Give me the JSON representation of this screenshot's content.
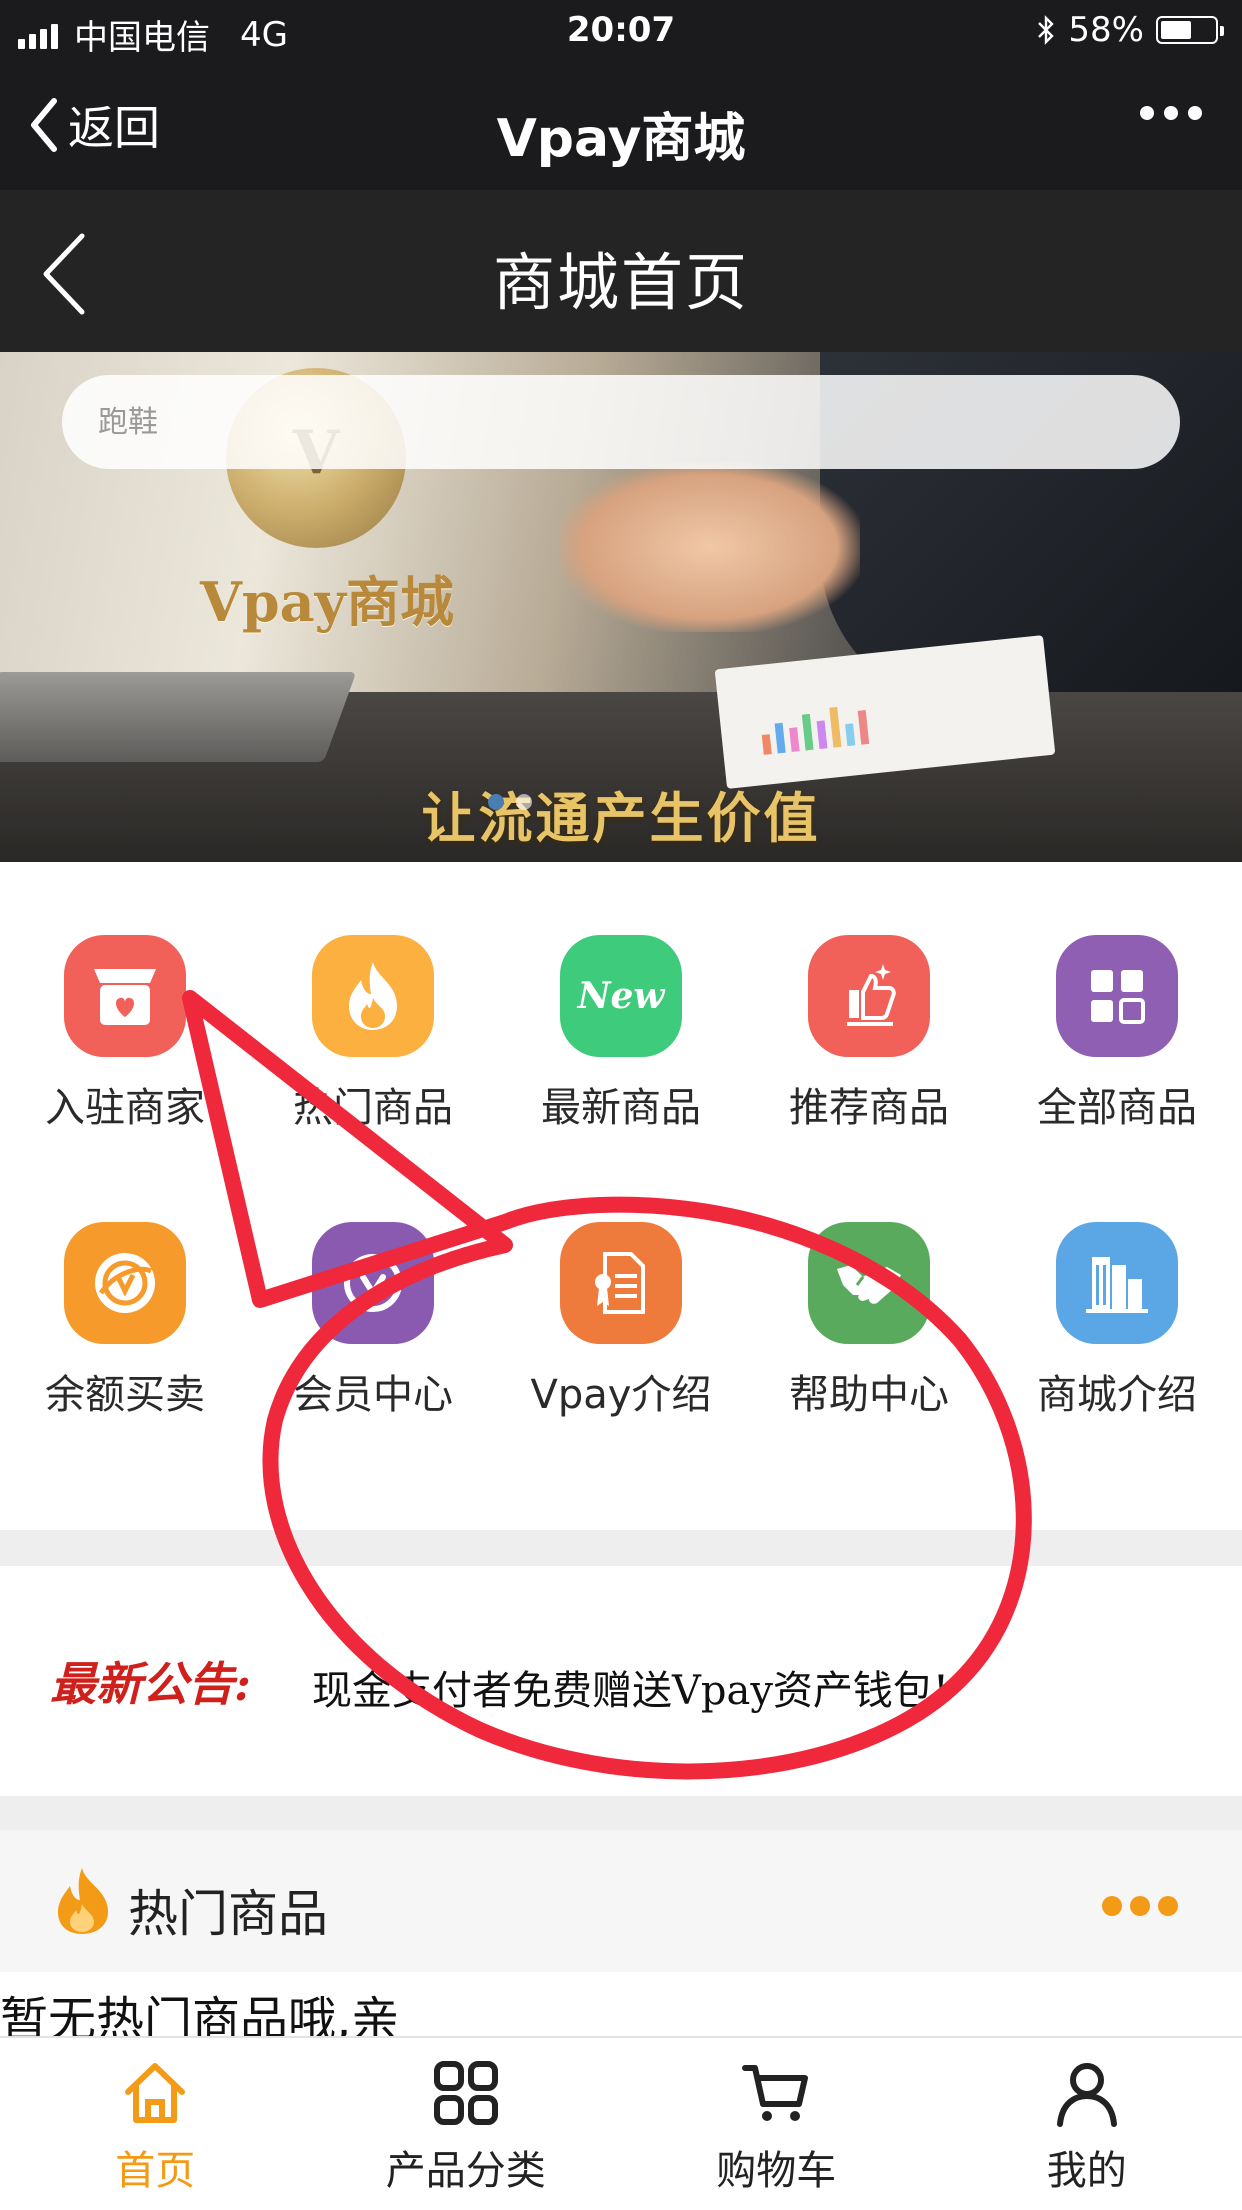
{
  "status_bar": {
    "carrier": "中国电信",
    "network": "4G",
    "time": "20:07",
    "battery": "58%",
    "battery_level": 0.58
  },
  "wechat_bar": {
    "back_label": "返回",
    "title": "Vpay商城"
  },
  "page_header": {
    "title": "商城首页"
  },
  "search": {
    "placeholder": "跑鞋"
  },
  "banner": {
    "brand": "Vpay商城",
    "slogan": "让流通产生价值"
  },
  "menu": [
    {
      "label": "入驻商家",
      "icon": "store-heart-icon",
      "color": "#f2605a"
    },
    {
      "label": "热门商品",
      "icon": "flame-icon",
      "color": "#fbb040"
    },
    {
      "label": "最新商品",
      "icon": "new-badge-icon",
      "icon_text": "New",
      "color": "#3ecb7b"
    },
    {
      "label": "推荐商品",
      "icon": "thumb-recommend-icon",
      "color": "#f2605a"
    },
    {
      "label": "全部商品",
      "icon": "grid-icon",
      "color": "#8e5fb3"
    },
    {
      "label": "余额买卖",
      "icon": "vpay-coin-icon",
      "color": "#f59a2b"
    },
    {
      "label": "会员中心",
      "icon": "member-badge-icon",
      "color": "#8a5ab0"
    },
    {
      "label": "Vpay介绍",
      "icon": "certificate-icon",
      "color": "#ee7a3c"
    },
    {
      "label": "帮助中心",
      "icon": "handshake-icon",
      "color": "#5aaa5e"
    },
    {
      "label": "商城介绍",
      "icon": "building-icon",
      "color": "#5ba7e6"
    }
  ],
  "notice": {
    "label": "最新公告:",
    "text": "现金支付者免费赠送Vpay资产钱包!"
  },
  "hot": {
    "title": "热门商品",
    "empty_text": "暂无热门商品哦,亲"
  },
  "tabbar": [
    {
      "label": "首页",
      "icon": "home-icon",
      "active": true
    },
    {
      "label": "产品分类",
      "icon": "category-grid-icon",
      "active": false
    },
    {
      "label": "购物车",
      "icon": "cart-icon",
      "active": false
    },
    {
      "label": "我的",
      "icon": "user-icon",
      "active": false
    }
  ],
  "colors": {
    "accent": "#f39a16",
    "annotation": "#f0283c",
    "notice_label": "#d0201b"
  }
}
